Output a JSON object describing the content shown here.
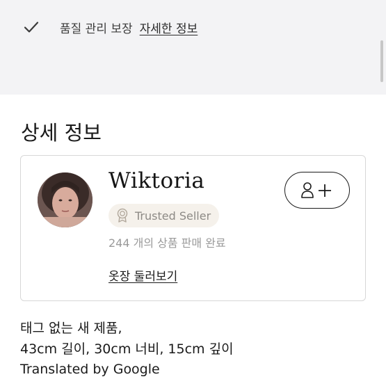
{
  "banner": {
    "icon": "checkmark-icon",
    "text": "품질 관리 보장",
    "link": "자세한 정보"
  },
  "section": {
    "title": "상세 정보"
  },
  "seller": {
    "name": "Wiktoria",
    "badge_label": "Trusted Seller",
    "badge_icon": "award-ribbon-icon",
    "sales": "244 개의 상품 판매 완료",
    "closet_link": "옷장 둘러보기",
    "follow_icon": "add-person-icon"
  },
  "description": {
    "lines": [
      "태그 없는 새 제품,",
      "43cm 길이, 30cm 너비, 15cm 깊이",
      "Translated by Google"
    ]
  },
  "colors": {
    "banner_bg": "#f3f3f5",
    "badge_bg": "#f5f1eb",
    "muted_text": "#9a9a9a"
  }
}
